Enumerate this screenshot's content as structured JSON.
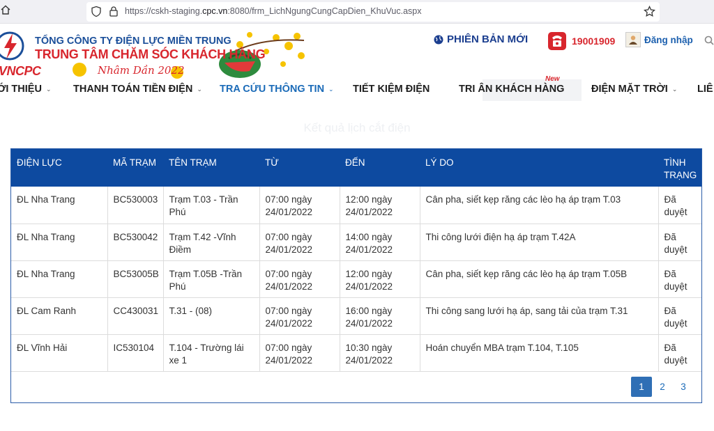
{
  "browser": {
    "url_prefix": "https://cskh-staging.",
    "url_domain": "cpc.vn",
    "url_suffix": ":8080/frm_LichNgungCungCapDien_KhuVuc.aspx"
  },
  "header": {
    "logo_text": "VNCPC",
    "org_line1": "TỔNG CÔNG TY ĐIỆN LỰC MIỀN TRUNG",
    "org_line2": "TRUNG TÂM CHĂM SÓC KHÁCH HÀNG",
    "tet_text": "Nhâm Dần 2022",
    "version_label": "PHIÊN BẢN MỚI",
    "hotline": "19001909",
    "login_label": "Đăng nhập"
  },
  "nav": {
    "items": [
      {
        "label": "ỚI THIỆU"
      },
      {
        "label": "THANH TOÁN TIỀN ĐIỆN"
      },
      {
        "label": "TRA CỨU THÔNG TIN"
      },
      {
        "label": "TIẾT KIỆM ĐIỆN"
      },
      {
        "label": "TRI ÂN KHÁCH HÀNG"
      },
      {
        "label": "ĐIỆN MẶT TRỜI"
      },
      {
        "label": "LIÊ"
      }
    ],
    "new_badge": "New"
  },
  "page_title": "Kết quả lịch cắt điện",
  "table": {
    "headers": [
      "ĐIỆN LỰC",
      "MÃ TRẠM",
      "TÊN TRẠM",
      "TỪ",
      "ĐẾN",
      "LÝ DO",
      "TÌNH TRẠNG"
    ],
    "rows": [
      [
        "ĐL Nha Trang",
        "BC530003",
        "Trạm T.03 - Trần Phú",
        "07:00 ngày 24/01/2022",
        "12:00 ngày 24/01/2022",
        "Cân pha, siết kẹp răng các lèo hạ áp trạm T.03",
        "Đã duyệt"
      ],
      [
        "ĐL Nha Trang",
        "BC530042",
        "Trạm T.42 -Vĩnh Điềm",
        "07:00 ngày 24/01/2022",
        "14:00 ngày 24/01/2022",
        "Thi công lưới điện hạ áp trạm T.42A",
        "Đã duyệt"
      ],
      [
        "ĐL Nha Trang",
        "BC53005B",
        "Trạm T.05B -Trần Phú",
        "07:00 ngày 24/01/2022",
        "12:00 ngày 24/01/2022",
        "Cân pha, siết kẹp răng các lèo hạ áp trạm T.05B",
        "Đã duyệt"
      ],
      [
        "ĐL Cam Ranh",
        "CC430031",
        "T.31 - (08)",
        "07:00 ngày 24/01/2022",
        "16:00 ngày 24/01/2022",
        "Thi công sang lưới hạ áp, sang tải của trạm T.31",
        "Đã duyệt"
      ],
      [
        "ĐL Vĩnh Hải",
        "IC530104",
        "T.104 - Trường lái xe 1",
        "07:00 ngày 24/01/2022",
        "10:30 ngày 24/01/2022",
        "Hoán chuyển MBA trạm T.104, T.105",
        "Đã duyệt"
      ]
    ]
  },
  "pagination": {
    "pages": [
      "1",
      "2",
      "3"
    ],
    "current": "1"
  },
  "colors": {
    "header_blue": "#0d4aa0",
    "brand_red": "#d8262d",
    "brand_blue": "#1b4f9a",
    "active_nav": "#1b6bb8"
  }
}
